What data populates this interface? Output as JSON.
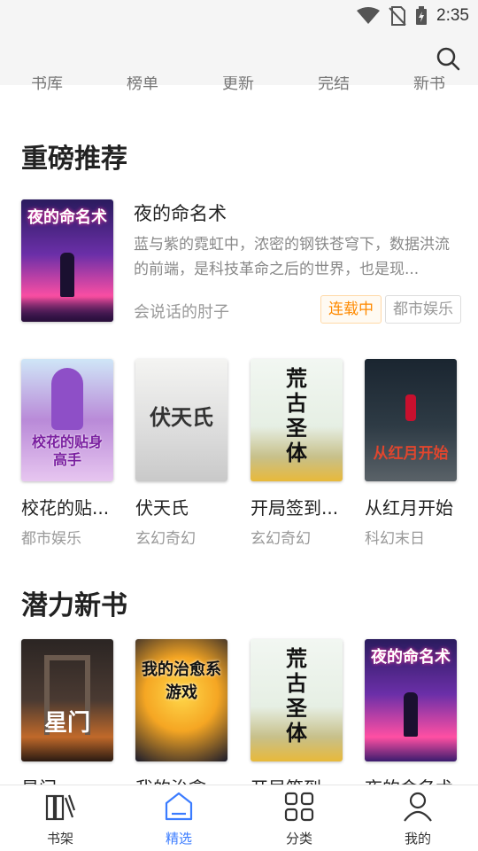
{
  "status_bar": {
    "time": "2:35",
    "icons": [
      "wifi-icon",
      "no-sim-icon",
      "battery-charging-icon"
    ]
  },
  "top_bar": {
    "search_icon": "search-icon"
  },
  "quick_nav": [
    "书库",
    "榜单",
    "更新",
    "完结",
    "新书"
  ],
  "sections": {
    "featured": {
      "title": "重磅推荐"
    },
    "potential": {
      "title": "潜力新书"
    }
  },
  "featured_book": {
    "title": "夜的命名术",
    "description": "蓝与紫的霓虹中，浓密的钢铁苍穹下，数据洪流的前端，是科技革命之后的世界，也是现...",
    "author": "会说话的肘子",
    "status_tag": "连载中",
    "genre_tag": "都市娱乐",
    "cover_text": "夜的命名术"
  },
  "book_grid": [
    {
      "title": "校花的贴...",
      "genre": "都市娱乐",
      "cover_text": "校花的贴身高手"
    },
    {
      "title": "伏天氏",
      "genre": "玄幻奇幻",
      "cover_text": "伏天氏"
    },
    {
      "title": "开局签到...",
      "genre": "玄幻奇幻",
      "cover_text": "荒古圣体"
    },
    {
      "title": "从红月开始",
      "genre": "科幻末日",
      "cover_text": "从红月开始"
    }
  ],
  "potential_grid": [
    {
      "title": "星门",
      "cover_text": "星门"
    },
    {
      "title": "我的治愈...",
      "cover_text": "我的治愈系游戏"
    },
    {
      "title": "开局签到...",
      "cover_text": "荒古圣体"
    },
    {
      "title": "夜的命名术",
      "cover_text": "夜的命名术"
    }
  ],
  "bottom_nav": [
    {
      "label": "书架",
      "icon": "bookshelf-icon"
    },
    {
      "label": "精选",
      "icon": "featured-icon",
      "active": true
    },
    {
      "label": "分类",
      "icon": "grid-icon"
    },
    {
      "label": "我的",
      "icon": "profile-icon"
    }
  ],
  "colors": {
    "accent": "#3b7cff",
    "status_tag": "#ff8a00",
    "background": "#ffffff",
    "topbar": "#f5f5f5"
  }
}
